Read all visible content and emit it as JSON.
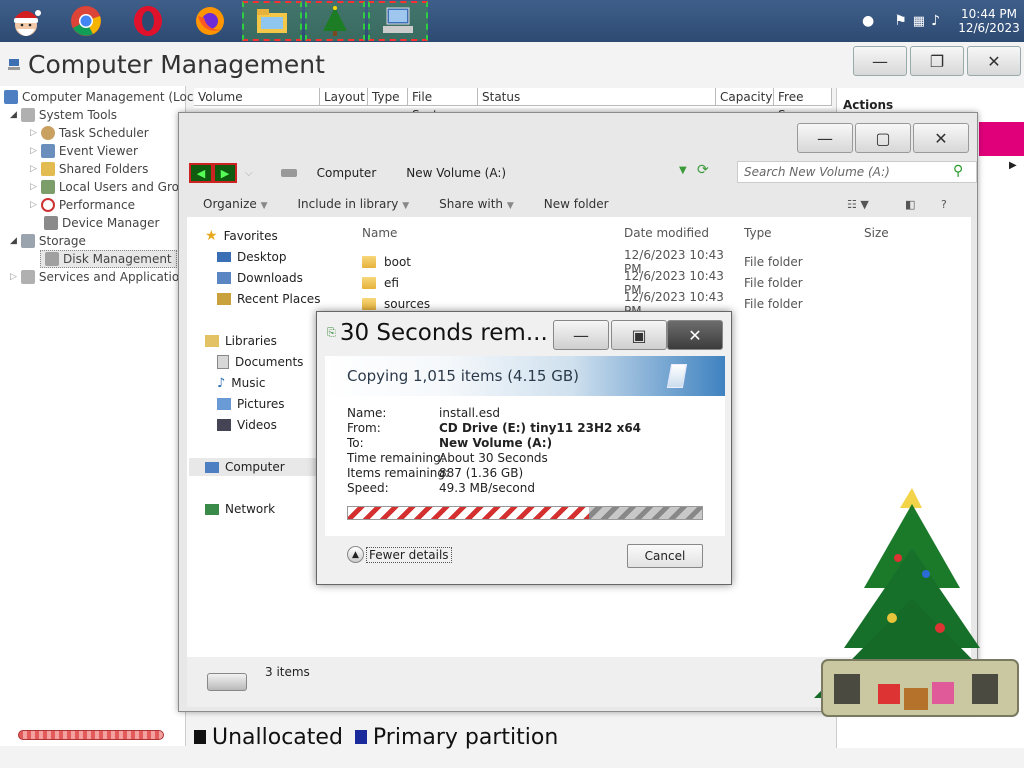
{
  "taskbar": {
    "icons": [
      "santa-icon",
      "chrome-icon",
      "opera-icon",
      "firefox-icon"
    ],
    "clock_time": "10:44 PM",
    "clock_date": "12/6/2023"
  },
  "computer_management": {
    "title": "Computer Management",
    "tree": {
      "root": "Computer Management (Local",
      "system_tools": "System Tools",
      "task_scheduler": "Task Scheduler",
      "event_viewer": "Event Viewer",
      "shared_folders": "Shared Folders",
      "local_users": "Local Users and Group",
      "performance": "Performance",
      "device_manager": "Device Manager",
      "storage": "Storage",
      "disk_management": "Disk Management",
      "services": "Services and Applications"
    },
    "volume_columns": [
      "Volume",
      "Layout",
      "Type",
      "File System",
      "Status",
      "Capacity",
      "Free Spac"
    ],
    "actions_label": "Actions",
    "legend": {
      "unallocated": "Unallocated",
      "primary": "Primary partition"
    }
  },
  "explorer": {
    "address": {
      "computer": "Computer",
      "volume": "New Volume (A:)"
    },
    "search_placeholder": "Search New Volume (A:)",
    "commands": {
      "organize": "Organize",
      "include": "Include in library",
      "share": "Share with",
      "new_folder": "New folder"
    },
    "nav": {
      "favorites": "Favorites",
      "desktop": "Desktop",
      "downloads": "Downloads",
      "recent": "Recent Places",
      "libraries": "Libraries",
      "documents": "Documents",
      "music": "Music",
      "pictures": "Pictures",
      "videos": "Videos",
      "computer": "Computer",
      "network": "Network"
    },
    "columns": {
      "name": "Name",
      "date": "Date modified",
      "type": "Type",
      "size": "Size"
    },
    "files": [
      {
        "name": "boot",
        "date": "12/6/2023 10:43 PM",
        "type": "File folder"
      },
      {
        "name": "efi",
        "date": "12/6/2023 10:43 PM",
        "type": "File folder"
      },
      {
        "name": "sources",
        "date": "12/6/2023 10:43 PM",
        "type": "File folder"
      }
    ],
    "status_items": "3 items"
  },
  "copy_dialog": {
    "title": "30 Seconds rem...",
    "heading": "Copying 1,015 items (4.15 GB)",
    "labels": {
      "name": "Name:",
      "from": "From:",
      "to": "To:",
      "time": "Time remaining:",
      "items": "Items remaining:",
      "speed": "Speed:"
    },
    "values": {
      "name": "install.esd",
      "from": "CD Drive (E:) tiny11 23H2 x64",
      "to": "New Volume (A:)",
      "time": "About 30 Seconds",
      "items": "887 (1.36 GB)",
      "speed": "49.3 MB/second"
    },
    "progress_percent": 68,
    "fewer_details": "Fewer details",
    "cancel": "Cancel"
  },
  "colors": {
    "taskbar": "#2d4a72",
    "progress_stripe": "#d43030",
    "banner_blue": "#3f82c0"
  }
}
